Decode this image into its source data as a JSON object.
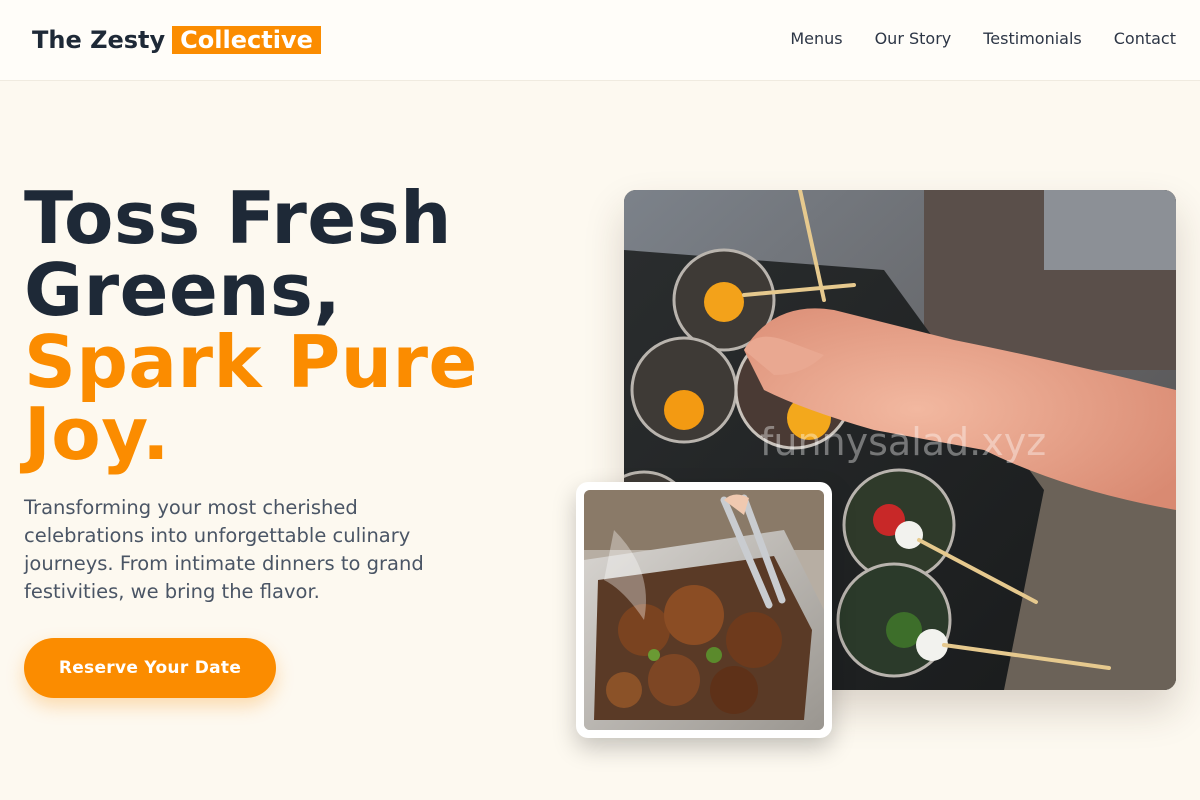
{
  "header": {
    "logo_main": "The Zesty",
    "logo_accent": "Collective",
    "nav": [
      {
        "label": "Menus"
      },
      {
        "label": "Our Story"
      },
      {
        "label": "Testimonials"
      },
      {
        "label": "Contact"
      }
    ]
  },
  "hero": {
    "headline_dark_1": "Toss Fresh",
    "headline_dark_2": "Greens,",
    "headline_accent_1": "Spark Pure",
    "headline_accent_2": "Joy.",
    "subtext": "Transforming your most cherished celebrations into unforgettable culinary journeys. From intimate dinners to grand festivities, we bring the flavor.",
    "cta_label": "Reserve Your Date"
  },
  "images": {
    "main_watermark": "funnysalad.xyz"
  },
  "colors": {
    "accent": "#fb8c00",
    "text_dark": "#1e2937",
    "background": "#fdf9f0"
  }
}
